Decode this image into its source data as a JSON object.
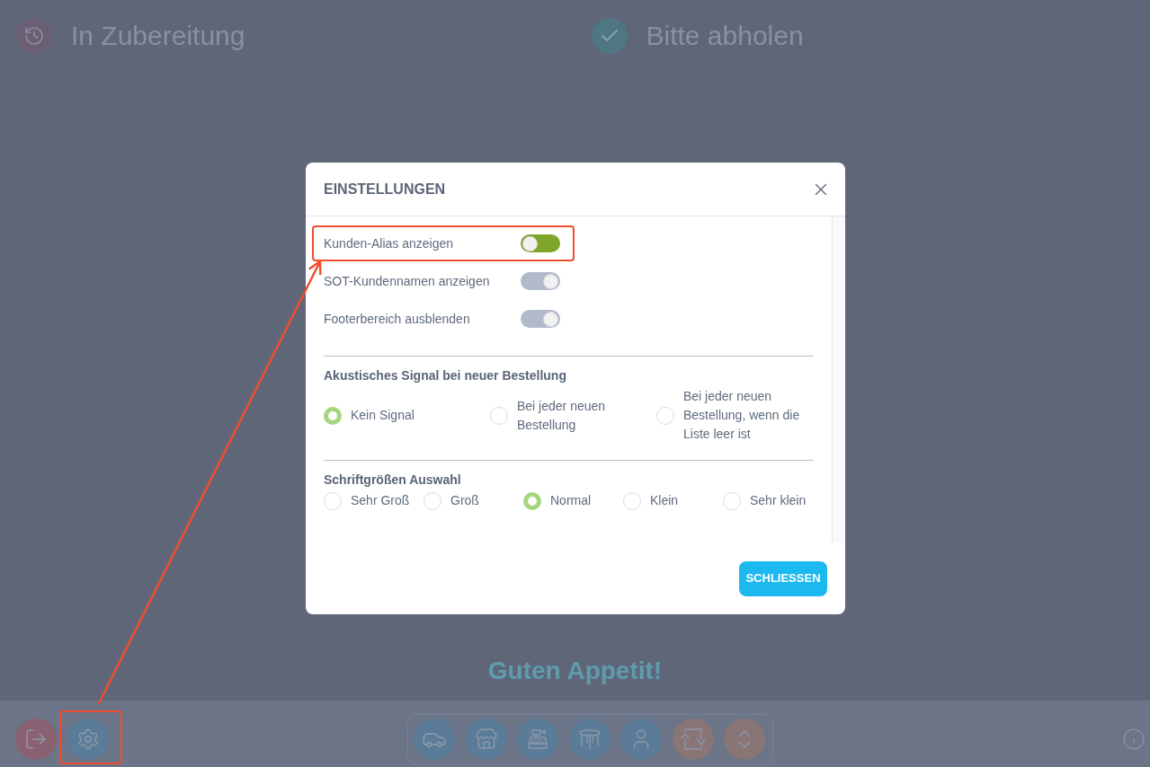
{
  "header": {
    "columns": [
      {
        "kind": "preparing",
        "title": "In Zubereitung"
      },
      {
        "kind": "ready",
        "title": "Bitte abholen"
      }
    ]
  },
  "message": "Guten Appetit!",
  "dialog": {
    "title": "EINSTELLUNGEN",
    "toggles": [
      {
        "label": "Kunden-Alias anzeigen",
        "on": false,
        "color": "#7fa62b"
      },
      {
        "label": "SOT-Kundennamen anzeigen",
        "on": true,
        "color": "#b1b9cb"
      },
      {
        "label": "Footerbereich ausblenden",
        "on": true,
        "color": "#b1b9cb"
      }
    ],
    "sections": [
      {
        "heading": "Akustisches Signal bei neuer Bestellung",
        "options": [
          {
            "label": "Kein Signal",
            "selected": true
          },
          {
            "label": "Bei jeder neuen Bestellung",
            "selected": false
          },
          {
            "label": "Bei jeder neuen Bestellung, wenn die Liste leer ist",
            "selected": false
          }
        ]
      },
      {
        "heading": "Schriftgrößen Auswahl",
        "options": [
          {
            "label": "Sehr Groß",
            "selected": false
          },
          {
            "label": "Groß",
            "selected": false
          },
          {
            "label": "Normal",
            "selected": true
          },
          {
            "label": "Klein",
            "selected": false
          },
          {
            "label": "Sehr klein",
            "selected": false
          }
        ]
      }
    ],
    "close_button": "SCHLIESSEN"
  }
}
